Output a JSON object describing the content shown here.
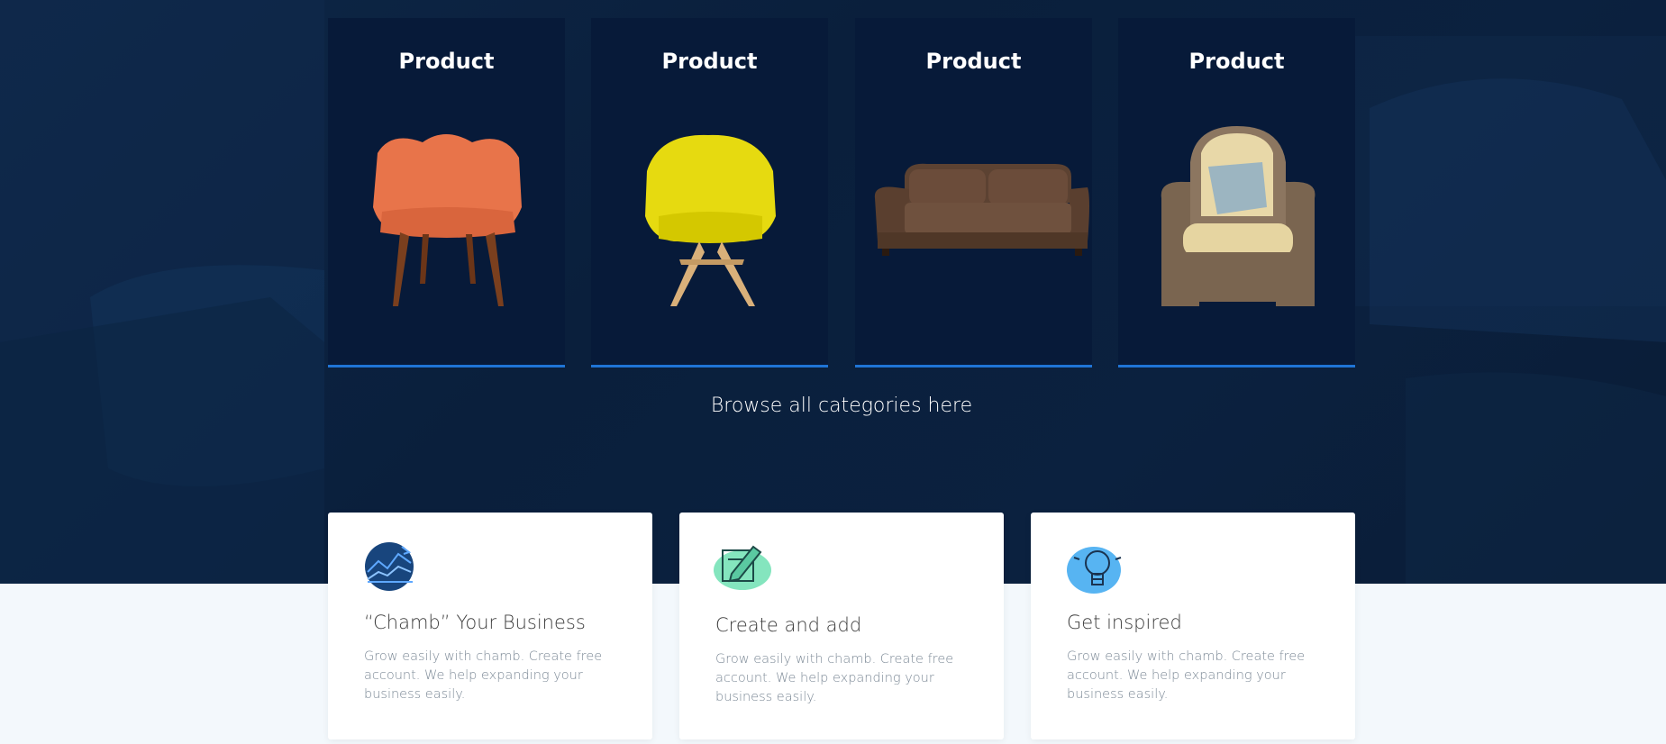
{
  "products": [
    {
      "title": "Product",
      "image": "orange-armchair"
    },
    {
      "title": "Product",
      "image": "yellow-armchair"
    },
    {
      "title": "Product",
      "image": "brown-sofa"
    },
    {
      "title": "Product",
      "image": "wicker-armchair"
    }
  ],
  "browse": {
    "label": "Browse all categories here"
  },
  "features": [
    {
      "icon": "chart-icon",
      "title": "“Chamb” Your Business",
      "desc": "Grow easily with chamb. Create free account. We help expanding your business easily."
    },
    {
      "icon": "edit-icon",
      "title": "Create and add",
      "desc": "Grow easily with chamb. Create free account. We help expanding your business easily."
    },
    {
      "icon": "lightbulb-icon",
      "title": "Get inspired",
      "desc": "Grow easily with chamb. Create free account. We help expanding your business easily."
    }
  ],
  "colors": {
    "hero_bg": "#0b213f",
    "card_bg": "#071a39",
    "accent": "#1f74d6",
    "page_bg": "#f3f8fc"
  }
}
